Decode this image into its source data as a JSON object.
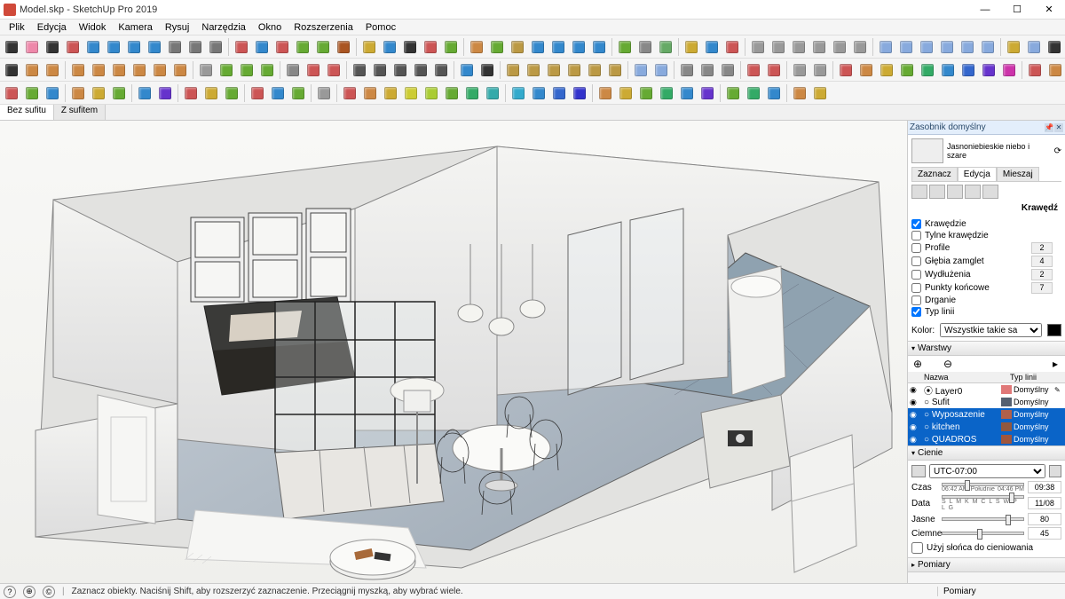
{
  "window": {
    "title": "Model.skp - SketchUp Pro 2019"
  },
  "menu": [
    "Plik",
    "Edycja",
    "Widok",
    "Kamera",
    "Rysuj",
    "Narzędzia",
    "Okno",
    "Rozszerzenia",
    "Pomoc"
  ],
  "winbtns": {
    "min": "—",
    "max": "☐",
    "close": "✕"
  },
  "scene_tabs": [
    "Bez sufitu",
    "Z sufitem"
  ],
  "tray": {
    "title": "Zasobnik domyślny",
    "style_name": "Jasnoniebieskie niebo i szare",
    "tabs": [
      "Zaznacz",
      "Edycja",
      "Mieszaj"
    ],
    "active_tab": 1,
    "section_label": "Krawędź",
    "edge_checks": [
      {
        "label": "Krawędzie",
        "checked": true,
        "num": ""
      },
      {
        "label": "Tylne krawędzie",
        "checked": false,
        "num": ""
      },
      {
        "label": "Profile",
        "checked": false,
        "num": "2"
      },
      {
        "label": "Głębia zamglet",
        "checked": false,
        "num": "4"
      },
      {
        "label": "Wydłużenia",
        "checked": false,
        "num": "2"
      },
      {
        "label": "Punkty końcowe",
        "checked": false,
        "num": "7"
      },
      {
        "label": "Drganie",
        "checked": false,
        "num": ""
      },
      {
        "label": "Typ linii",
        "checked": true,
        "num": ""
      }
    ],
    "kolor_label": "Kolor:",
    "kolor_select": "Wszystkie takie sa"
  },
  "layers": {
    "title": "Warstwy",
    "head": [
      "Nazwa",
      "Typ linii"
    ],
    "rows": [
      {
        "vis": true,
        "radio": true,
        "name": "Layer0",
        "color": "#e07878",
        "type": "Domyślny",
        "sel": false,
        "pen": true
      },
      {
        "vis": true,
        "radio": false,
        "name": "Sufit",
        "color": "#556070",
        "type": "Domyślny",
        "sel": false,
        "pen": false
      },
      {
        "vis": true,
        "radio": false,
        "name": "Wyposazenie",
        "color": "#b0604a",
        "type": "Domyślny",
        "sel": true,
        "pen": false
      },
      {
        "vis": true,
        "radio": false,
        "name": "kitchen",
        "color": "#905840",
        "type": "Domyślny",
        "sel": true,
        "pen": false
      },
      {
        "vis": true,
        "radio": false,
        "name": "QUADROS",
        "color": "#a0563c",
        "type": "Domyślny",
        "sel": true,
        "pen": false
      }
    ]
  },
  "shadows": {
    "title": "Cienie",
    "tz": "UTC-07:00",
    "czas_label": "Czas",
    "czas_start": "06:42 AM",
    "czas_mid": "Południe",
    "czas_end": "04:46 PM",
    "czas_val": "09:38",
    "data_label": "Data",
    "data_scale": "S L M K M C L S W P L G",
    "data_val": "11/08",
    "jasne_label": "Jasne",
    "jasne_val": "80",
    "ciemne_label": "Ciemne",
    "ciemne_val": "45",
    "use_sun": "Użyj słońca do cieniowania"
  },
  "pomiary_title": "Pomiary",
  "status": {
    "hint": "Zaznacz obiekty. Naciśnij Shift, aby rozszerzyć zaznaczenie. Przeciągnij myszką, aby wybrać wiele.",
    "pomiary": "Pomiary"
  },
  "toolrows": [
    [
      "select",
      "eraser",
      "line",
      "freehand",
      "arc",
      "arc2",
      "arc3",
      "arc4",
      "rect",
      "circle",
      "poly",
      "|",
      "pushpull",
      "offset",
      "move",
      "rotate",
      "scale",
      "follow",
      "|",
      "tape",
      "dim",
      "text",
      "axes",
      "protractor",
      "|",
      "paint",
      "orbit",
      "pan",
      "zoom",
      "zoomext",
      "zoomwin",
      "prev",
      "|",
      "circle2",
      "tube",
      "soap",
      "|",
      "walk",
      "look",
      "section",
      "|",
      "iso",
      "top",
      "front",
      "right",
      "back",
      "left",
      "|",
      "xray",
      "hidden",
      "wire",
      "shaded",
      "tex",
      "mono",
      "|",
      "shadows",
      "fog",
      "edges",
      "profile2",
      "|",
      "proj",
      "persp",
      "2pt",
      "|",
      "3dw",
      "ext",
      "wh",
      "comp",
      "|",
      "layers",
      "outliner",
      "scenes",
      "|",
      "info",
      "sun",
      "geo",
      "|",
      "solid1",
      "solid2",
      "solid3",
      "solid4",
      "solid5",
      "solid6"
    ],
    [
      "cursor",
      "rect2",
      "rrect",
      "|",
      "cube",
      "cyl",
      "sphere",
      "cone",
      "torus",
      "prism",
      "|",
      "grid",
      "dynC",
      "dynI",
      "dynO",
      "|",
      "opts",
      "layer+",
      "layer-",
      "|",
      "chk1",
      "chk2",
      "chk3",
      "chk4",
      "chk5",
      "|",
      "dim2",
      "text2",
      "|",
      "sand1",
      "sand2",
      "sand3",
      "sand4",
      "sand5",
      "sand6",
      "|",
      "tex1",
      "tex2",
      "|",
      "style1",
      "style2",
      "style3",
      "|",
      "solid7",
      "solid8",
      "|",
      "face1",
      "face2",
      "|",
      "m1",
      "m2",
      "m3",
      "m4",
      "m5",
      "m6",
      "m7",
      "m8",
      "m9",
      "|",
      "c1",
      "c2",
      "c3",
      "c4",
      "c5",
      "c6",
      "c7",
      "c8",
      "|",
      "tree",
      "bush",
      "rock"
    ],
    [
      "rot1",
      "rot2",
      "rot3",
      "|",
      "scale1",
      "scale2",
      "scale3",
      "|",
      "mir1",
      "mir2",
      "|",
      "al1",
      "al2",
      "al3",
      "|",
      "sp1",
      "sp2",
      "sp3",
      "|",
      "grid2",
      "|",
      "b1",
      "b2",
      "b3",
      "b4",
      "b5",
      "b6",
      "b7",
      "b8",
      "|",
      "r1",
      "r2",
      "r3",
      "r4",
      "|",
      "y1",
      "y2",
      "y3",
      "y4",
      "y5",
      "y6",
      "|",
      "g1",
      "g2",
      "g3",
      "|",
      "o1",
      "o2"
    ]
  ],
  "tool_colors": {
    "row0": [
      "#333",
      "#e8a",
      "#333",
      "#c55",
      "#38c",
      "#38c",
      "#38c",
      "#38c",
      "#777",
      "#777",
      "#777",
      "",
      "#c55",
      "#38c",
      "#c55",
      "#6a3",
      "#6a3",
      "#a52",
      "",
      "#ca3",
      "#38c",
      "#333",
      "#c55",
      "#6a3",
      "",
      "#c84",
      "#6a3",
      "#b94",
      "#38c",
      "#38c",
      "#38c",
      "#38c",
      "",
      "#6a3",
      "#888",
      "#6a6",
      "",
      "#ca3",
      "#38c",
      "#c55",
      "",
      "#999",
      "#999",
      "#999",
      "#999",
      "#999",
      "#999",
      "",
      "#8ad",
      "#8ad",
      "#8ad",
      "#8ad",
      "#8ad",
      "#8ad",
      "",
      "#ca3",
      "#8ad",
      "#333",
      "#333",
      "",
      "#999",
      "#999",
      "#999",
      "",
      "#c55",
      "#6a3",
      "#38c",
      "#ca3",
      "",
      "#c55",
      "#6a3",
      "#38c",
      "",
      "#333",
      "#ca3",
      "#6a3",
      "",
      "#888",
      "#888",
      "#888",
      "#888",
      "#888",
      "#888"
    ],
    "row1": [
      "#333",
      "#c84",
      "#c84",
      "",
      "#c84",
      "#c84",
      "#c84",
      "#c84",
      "#c84",
      "#c84",
      "",
      "#999",
      "#6a3",
      "#6a3",
      "#6a3",
      "",
      "#888",
      "#c55",
      "#c55",
      "",
      "#555",
      "#555",
      "#555",
      "#555",
      "#555",
      "",
      "#38c",
      "#333",
      "",
      "#b94",
      "#b94",
      "#b94",
      "#b94",
      "#b94",
      "#b94",
      "",
      "#8ad",
      "#8ad",
      "",
      "#888",
      "#888",
      "#888",
      "",
      "#c55",
      "#c55",
      "",
      "#999",
      "#999",
      "",
      "#c55",
      "#c84",
      "#ca3",
      "#6a3",
      "#3a6",
      "#38c",
      "#36c",
      "#63c",
      "#c3a",
      "",
      "#c55",
      "#c84",
      "#ca3",
      "#6a3",
      "#3a6",
      "#38c",
      "#36c",
      "#63c",
      "",
      "#3a5",
      "#5a3",
      "#888"
    ],
    "row2": [
      "#c55",
      "#6a3",
      "#38c",
      "",
      "#c84",
      "#ca3",
      "#6a3",
      "",
      "#38c",
      "#63c",
      "",
      "#c55",
      "#ca3",
      "#6a3",
      "",
      "#c55",
      "#38c",
      "#6a3",
      "",
      "#999",
      "",
      "#c55",
      "#c84",
      "#ca3",
      "#cc3",
      "#ac3",
      "#6a3",
      "#3a6",
      "#3aa",
      "",
      "#3ac",
      "#38c",
      "#36c",
      "#33c",
      "",
      "#c84",
      "#ca3",
      "#6a3",
      "#3a6",
      "#38c",
      "#63c",
      "",
      "#6a3",
      "#3a6",
      "#38c",
      "",
      "#c84",
      "#ca3"
    ]
  }
}
